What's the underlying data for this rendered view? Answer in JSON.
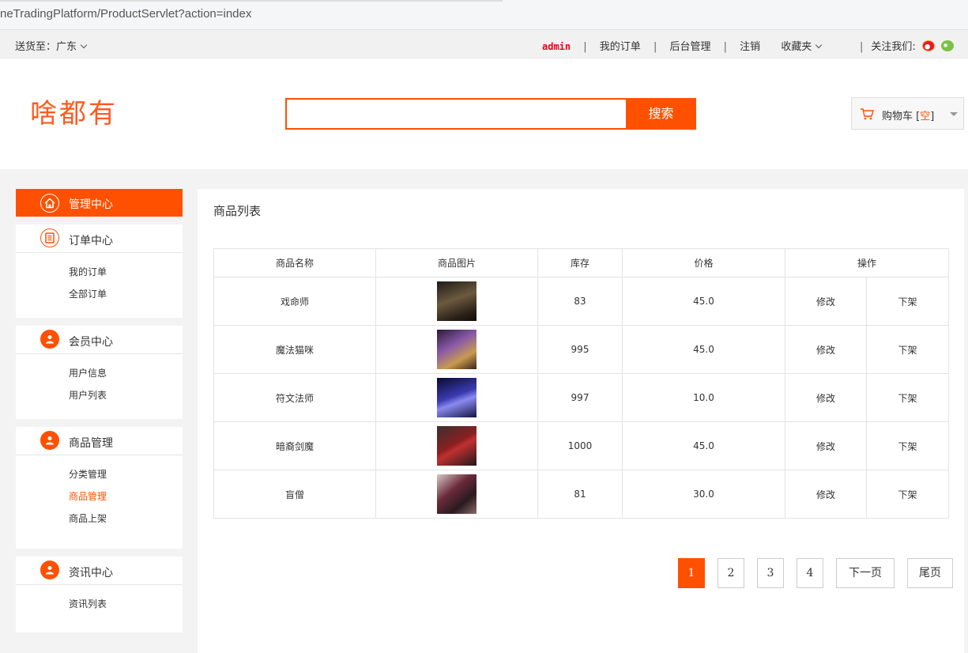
{
  "browser": {
    "url": "neTradingPlatform/ProductServlet?action=index"
  },
  "topnav": {
    "ship_label": "送货至：广东",
    "user": "admin",
    "my_orders": "我的订单",
    "admin_panel": "后台管理",
    "logout": "注销",
    "favorites": "收藏夹",
    "follow_us": "关注我们:"
  },
  "header": {
    "logo": "啥都有",
    "search_placeholder": "",
    "search_button": "搜索",
    "cart_label": "购物车 [",
    "cart_status": "空",
    "cart_close": "]"
  },
  "sidebar": {
    "head": "管理中心",
    "sections": [
      {
        "title": "订单中心",
        "items": [
          "我的订单",
          "全部订单"
        ]
      },
      {
        "title": "会员中心",
        "items": [
          "用户信息",
          "用户列表"
        ]
      },
      {
        "title": "商品管理",
        "items": [
          "分类管理",
          "商品管理",
          "商品上架"
        ]
      },
      {
        "title": "资讯中心",
        "items": [
          "资讯列表"
        ]
      }
    ]
  },
  "main": {
    "title": "商品列表",
    "table": {
      "headers": [
        "商品名称",
        "商品图片",
        "库存",
        "价格",
        "操作"
      ],
      "rows": [
        {
          "name": "戏命师",
          "stock": "83",
          "price": "45.0",
          "edit": "修改",
          "off": "下架"
        },
        {
          "name": "魔法猫咪",
          "stock": "995",
          "price": "45.0",
          "edit": "修改",
          "off": "下架"
        },
        {
          "name": "符文法师",
          "stock": "997",
          "price": "10.0",
          "edit": "修改",
          "off": "下架"
        },
        {
          "name": "暗裔剑魔",
          "stock": "1000",
          "price": "45.0",
          "edit": "修改",
          "off": "下架"
        },
        {
          "name": "盲僧",
          "stock": "81",
          "price": "30.0",
          "edit": "修改",
          "off": "下架"
        }
      ]
    },
    "pager": {
      "pages": [
        "1",
        "2",
        "3",
        "4"
      ],
      "next": "下一页",
      "last": "尾页",
      "current": "1"
    }
  },
  "colors": {
    "accent": "#ff5000",
    "admin": "#e4001b"
  }
}
